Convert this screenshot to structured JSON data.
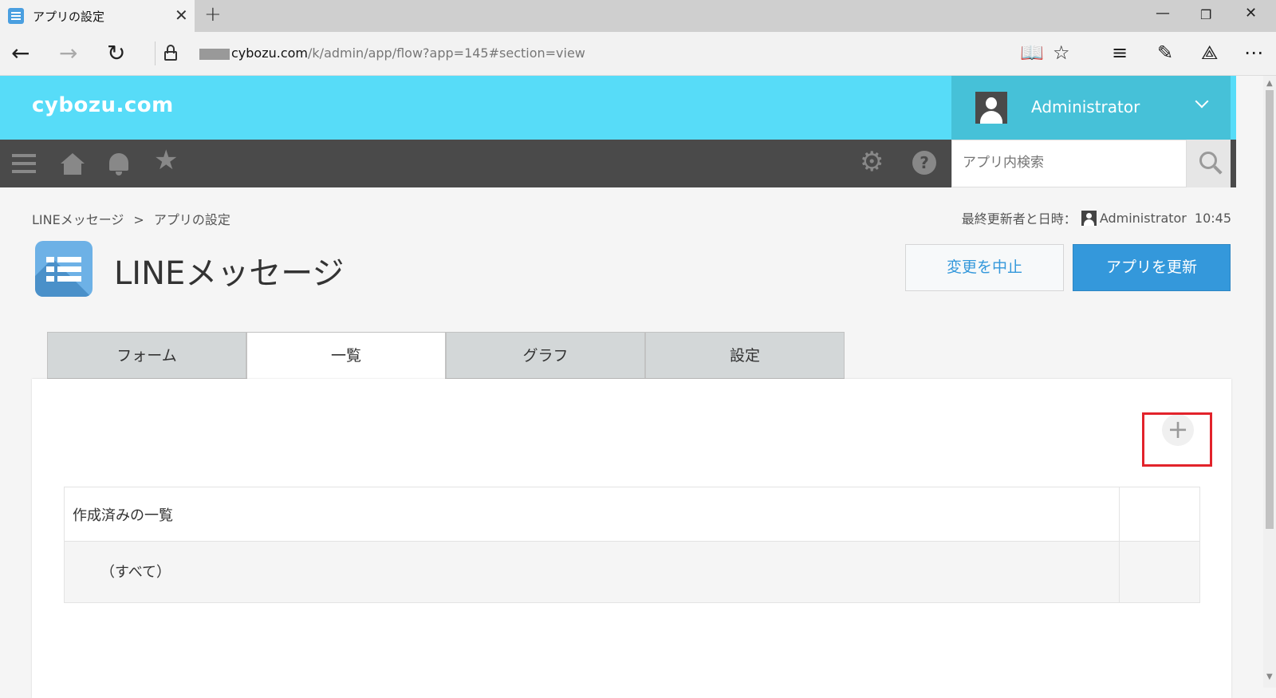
{
  "browser": {
    "tab_title": "アプリの設定",
    "url_domain": "cybozu.com",
    "url_path": "/k/admin/app/flow?app=145#section=view"
  },
  "header": {
    "logo": "cybozu.com",
    "user_name": "Administrator",
    "search_placeholder": "アプリ内検索"
  },
  "breadcrumb": {
    "app": "LINEメッセージ",
    "separator": ">",
    "current": "アプリの設定"
  },
  "updated": {
    "label": "最終更新者と日時：",
    "user": "Administrator",
    "time": "10:45"
  },
  "app": {
    "title": "LINEメッセージ",
    "cancel_label": "変更を中止",
    "update_label": "アプリを更新"
  },
  "tabs": [
    {
      "label": "フォーム"
    },
    {
      "label": "一覧"
    },
    {
      "label": "グラフ"
    },
    {
      "label": "設定"
    }
  ],
  "views": {
    "header": "作成済みの一覧",
    "items": [
      {
        "label": "（すべて）"
      }
    ]
  },
  "colors": {
    "header_bg": "#57dcf8",
    "accent": "#3498db",
    "highlight": "#e2232b"
  }
}
